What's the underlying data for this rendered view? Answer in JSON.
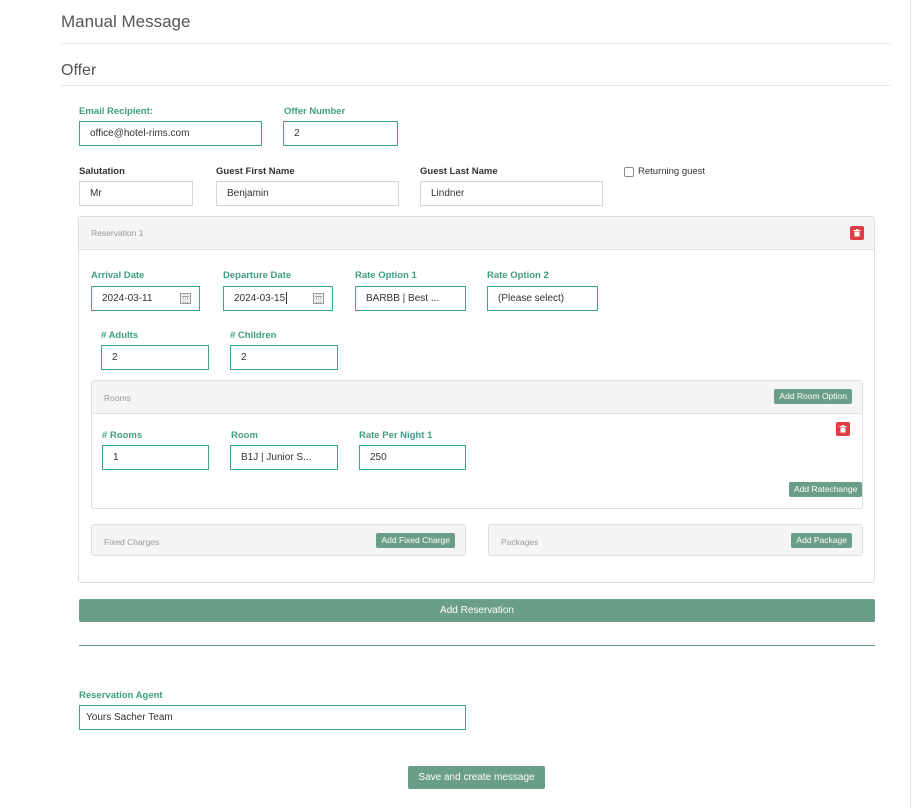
{
  "page": {
    "title": "Manual Message"
  },
  "offer": {
    "section_title": "Offer",
    "email_label": "Email Recipient:",
    "email_value": "office@hotel-rims.com",
    "offer_number_label": "Offer Number",
    "offer_number_value": "2",
    "salutation_label": "Salutation",
    "salutation_value": "Mr",
    "first_name_label": "Guest First Name",
    "first_name_value": "Benjamin",
    "last_name_label": "Guest Last Name",
    "last_name_value": "Lindner",
    "returning_guest_label": "Returning guest"
  },
  "reservation": {
    "title": "Reservation 1",
    "arrival_label": "Arrival Date",
    "arrival_value": "2024-03-11",
    "departure_label": "Departure Date",
    "departure_value": "2024-03-15",
    "rate1_label": "Rate Option 1",
    "rate1_value": "BARBB | Best ...",
    "rate2_label": "Rate Option 2",
    "rate2_value": "(Please select)",
    "adults_label": "# Adults",
    "adults_value": "2",
    "children_label": "# Children",
    "children_value": "2",
    "rooms": {
      "title": "Rooms",
      "add_room_option": "Add Room Option",
      "count_label": "# Rooms",
      "count_value": "1",
      "room_label": "Room",
      "room_value": "B1J | Junior S...",
      "rate_label": "Rate Per Night 1",
      "rate_value": "250",
      "add_ratechange": "Add Ratechange"
    },
    "fixed_charges": {
      "title": "Fixed Charges",
      "add_label": "Add Fixed Charge"
    },
    "packages": {
      "title": "Packages",
      "add_label": "Add Package"
    }
  },
  "add_reservation": "Add Reservation",
  "agent": {
    "label": "Reservation Agent",
    "value": "Yours Sacher Team"
  },
  "save_button": "Save and create message",
  "colors": {
    "accent": "#3aa78a",
    "button": "#6b9e88",
    "delete": "#e23c44"
  }
}
